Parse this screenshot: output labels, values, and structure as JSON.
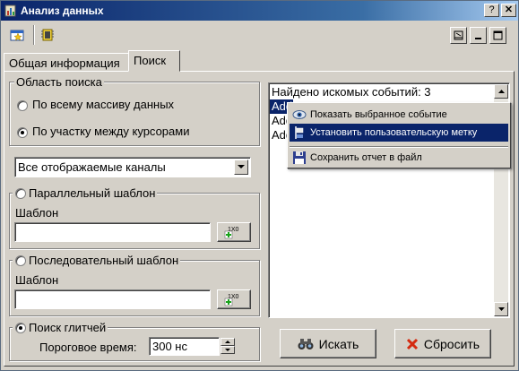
{
  "window": {
    "title": "Анализ данных",
    "help_glyph": "?",
    "close_glyph": "✕"
  },
  "tabs": [
    {
      "label": "Общая информация"
    },
    {
      "label": "Поиск"
    }
  ],
  "search_area": {
    "legend": "Область поиска",
    "options": [
      {
        "label": "По всему массиву данных",
        "selected": false
      },
      {
        "label": "По участку между курсорами",
        "selected": true
      }
    ]
  },
  "channels": {
    "selected": "Все отображаемые каналы"
  },
  "parallel": {
    "label": "Параллельный шаблон",
    "selected": false,
    "field_label": "Шаблон",
    "value": ""
  },
  "sequential": {
    "label": "Последовательный шаблон",
    "selected": false,
    "field_label": "Шаблон",
    "value": ""
  },
  "glitch": {
    "label": "Поиск глитчей",
    "selected": true,
    "threshold_label": "Пороговое время:",
    "threshold_value": "300 нс"
  },
  "results": {
    "header": "Найдено искомых событий: 3",
    "items": [
      "Add",
      "Add",
      "Add"
    ]
  },
  "context_menu": {
    "items": [
      {
        "label": "Показать выбранное событие",
        "icon": "eye-icon",
        "highlighted": false
      },
      {
        "label": "Установить пользовательскую метку",
        "icon": "marker-icon",
        "highlighted": true
      },
      {
        "label": "Сохранить отчет в файл",
        "icon": "save-icon",
        "highlighted": false
      }
    ]
  },
  "actions": {
    "search_label": "Искать",
    "reset_label": "Сбросить"
  },
  "colors": {
    "highlight": "#0a246a",
    "title_start": "#0a246a",
    "title_end": "#a6caf0",
    "reset_x": "#d42a10",
    "add_plus": "#1aa31a"
  }
}
